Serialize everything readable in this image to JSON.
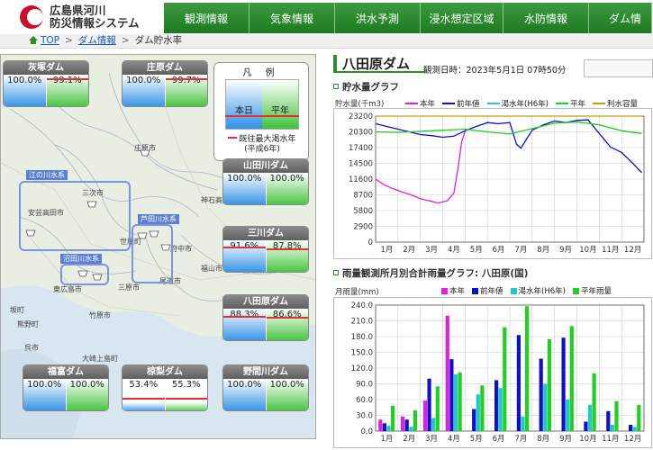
{
  "header": {
    "title_line1": "広島県河川",
    "title_line2": "防災情報システム",
    "nav": [
      "観測情報",
      "気象情報",
      "洪水予測",
      "浸水想定区域",
      "水防情報",
      "ダム情"
    ]
  },
  "breadcrumb": {
    "top": "TOP",
    "dam_info": "ダム情報",
    "current": "ダム貯水率"
  },
  "legend": {
    "title": "凡 例",
    "today": "本日",
    "average": "平年",
    "note_line1": "既往最大渇水年",
    "note_line2": "(平成6年)"
  },
  "dams": [
    {
      "name": "灰塚ダム",
      "today": "100.0%",
      "average": "99.1%",
      "today_fill": 1.0,
      "average_fill": 0.99
    },
    {
      "name": "庄原ダム",
      "today": "100.0%",
      "average": "99.7%",
      "today_fill": 1.0,
      "average_fill": 0.997
    },
    {
      "name": "山田川ダム",
      "today": "100.0%",
      "average": "100.0%",
      "today_fill": 1.0,
      "average_fill": 1.0
    },
    {
      "name": "三川ダム",
      "today": "91.6%",
      "average": "87.8%",
      "today_fill": 0.916,
      "average_fill": 0.878
    },
    {
      "name": "八田原ダム",
      "today": "88.3%",
      "average": "86.6%",
      "today_fill": 0.883,
      "average_fill": 0.866
    },
    {
      "name": "福富ダム",
      "today": "100.0%",
      "average": "100.0%",
      "today_fill": 1.0,
      "average_fill": 1.0
    },
    {
      "name": "椋梨ダム",
      "today": "53.4%",
      "average": "55.3%",
      "today_fill": 0.534,
      "average_fill": 0.553
    },
    {
      "name": "野間川ダム",
      "today": "100.0%",
      "average": "100.0%",
      "today_fill": 1.0,
      "average_fill": 1.0
    }
  ],
  "map": {
    "cities": [
      "庄原市",
      "三次市",
      "安芸高田市",
      "世羅町",
      "府中市",
      "神石高原町",
      "福山市",
      "尾道市",
      "三原市",
      "東広島市",
      "竹原市",
      "熊野町",
      "呉市",
      "大崎上島町",
      "坂町"
    ],
    "water_systems": [
      "江の川水系",
      "芦田川水系",
      "沼田川水系"
    ]
  },
  "main": {
    "dam_title": "八田原ダム",
    "obs_time": "観測日時：2023年5月1日 07時50分"
  },
  "colors": {
    "this_year": "#e020e0",
    "last_year": "#1010c8",
    "drought_year": "#20c8c8",
    "average": "#20d020",
    "usable_capacity": "#c8a000"
  },
  "chart_data": [
    {
      "type": "line",
      "title": "貯水量グラフ",
      "ylabel": "貯水量(千m3)",
      "categories": [
        "1月",
        "2月",
        "3月",
        "4月",
        "5月",
        "6月",
        "7月",
        "8月",
        "9月",
        "10月",
        "11月",
        "12月"
      ],
      "yticks": [
        0,
        2900,
        5800,
        8700,
        11600,
        14500,
        17400,
        20300,
        23200
      ],
      "ylim": [
        0,
        23200
      ],
      "series": [
        {
          "name": "本年",
          "color": "#e020e0",
          "x": [
            0.0,
            0.4,
            0.8,
            1.2,
            1.6,
            2.0,
            2.4,
            2.8,
            3.2,
            3.5,
            3.7,
            3.85,
            4.0
          ],
          "values": [
            11600,
            10500,
            9800,
            9200,
            8700,
            8000,
            7600,
            7200,
            7600,
            9000,
            14000,
            18500,
            20400
          ]
        },
        {
          "name": "前年値",
          "color": "#1010c8",
          "x": [
            0.0,
            0.5,
            1.0,
            1.5,
            2.0,
            2.5,
            3.0,
            3.5,
            4.0,
            4.5,
            5.0,
            5.5,
            6.0,
            6.3,
            6.5,
            7.0,
            7.5,
            8.0,
            8.5,
            9.0,
            9.5,
            10.0,
            10.5,
            11.0,
            11.5,
            11.9
          ],
          "values": [
            21800,
            21300,
            20800,
            20300,
            19800,
            19600,
            19300,
            19500,
            20500,
            21300,
            22000,
            21800,
            22000,
            18000,
            17300,
            20600,
            21600,
            22300,
            22000,
            22400,
            22500,
            20000,
            17500,
            16500,
            14500,
            12800
          ]
        },
        {
          "name": "渇水年(H6年)",
          "color": "#20c8c8",
          "x": [],
          "values": []
        },
        {
          "name": "平年",
          "color": "#20d020",
          "x": [
            0.0,
            1.0,
            2.0,
            3.0,
            4.0,
            5.0,
            6.0,
            7.0,
            8.0,
            9.0,
            10.0,
            11.0,
            11.9
          ],
          "values": [
            20300,
            20200,
            20400,
            20600,
            20800,
            20300,
            19900,
            20900,
            21900,
            22100,
            21600,
            20500,
            20000
          ]
        },
        {
          "name": "利水容量",
          "color": "#c8a000",
          "x": [
            0.0,
            11.9
          ],
          "values": [
            23200,
            23200
          ]
        }
      ]
    },
    {
      "type": "bar",
      "title": "雨量観測所月別合計雨量グラフ: 八田原(国)",
      "ylabel": "月雨量(mm)",
      "categories": [
        "1月",
        "2月",
        "3月",
        "4月",
        "5月",
        "6月",
        "7月",
        "8月",
        "9月",
        "10月",
        "11月",
        "12月"
      ],
      "yticks": [
        0,
        30.0,
        60.0,
        90.0,
        120.0,
        150.0,
        180.0,
        210.0,
        240.0
      ],
      "ylim": [
        0,
        240
      ],
      "series": [
        {
          "name": "本年",
          "color": "#e020e0",
          "values": [
            22,
            28,
            58,
            220,
            0,
            0,
            0,
            0,
            0,
            0,
            0,
            0
          ]
        },
        {
          "name": "前年値",
          "color": "#1010c8",
          "values": [
            15,
            22,
            100,
            137,
            42,
            97,
            183,
            138,
            178,
            18,
            38,
            12
          ]
        },
        {
          "name": "渇水年(H6年)",
          "color": "#20c8c8",
          "values": [
            10,
            8,
            25,
            108,
            70,
            82,
            28,
            90,
            60,
            50,
            12,
            8
          ]
        },
        {
          "name": "平年雨量",
          "color": "#20d020",
          "values": [
            48,
            40,
            85,
            112,
            87,
            198,
            238,
            175,
            200,
            110,
            57,
            50
          ]
        }
      ]
    }
  ]
}
